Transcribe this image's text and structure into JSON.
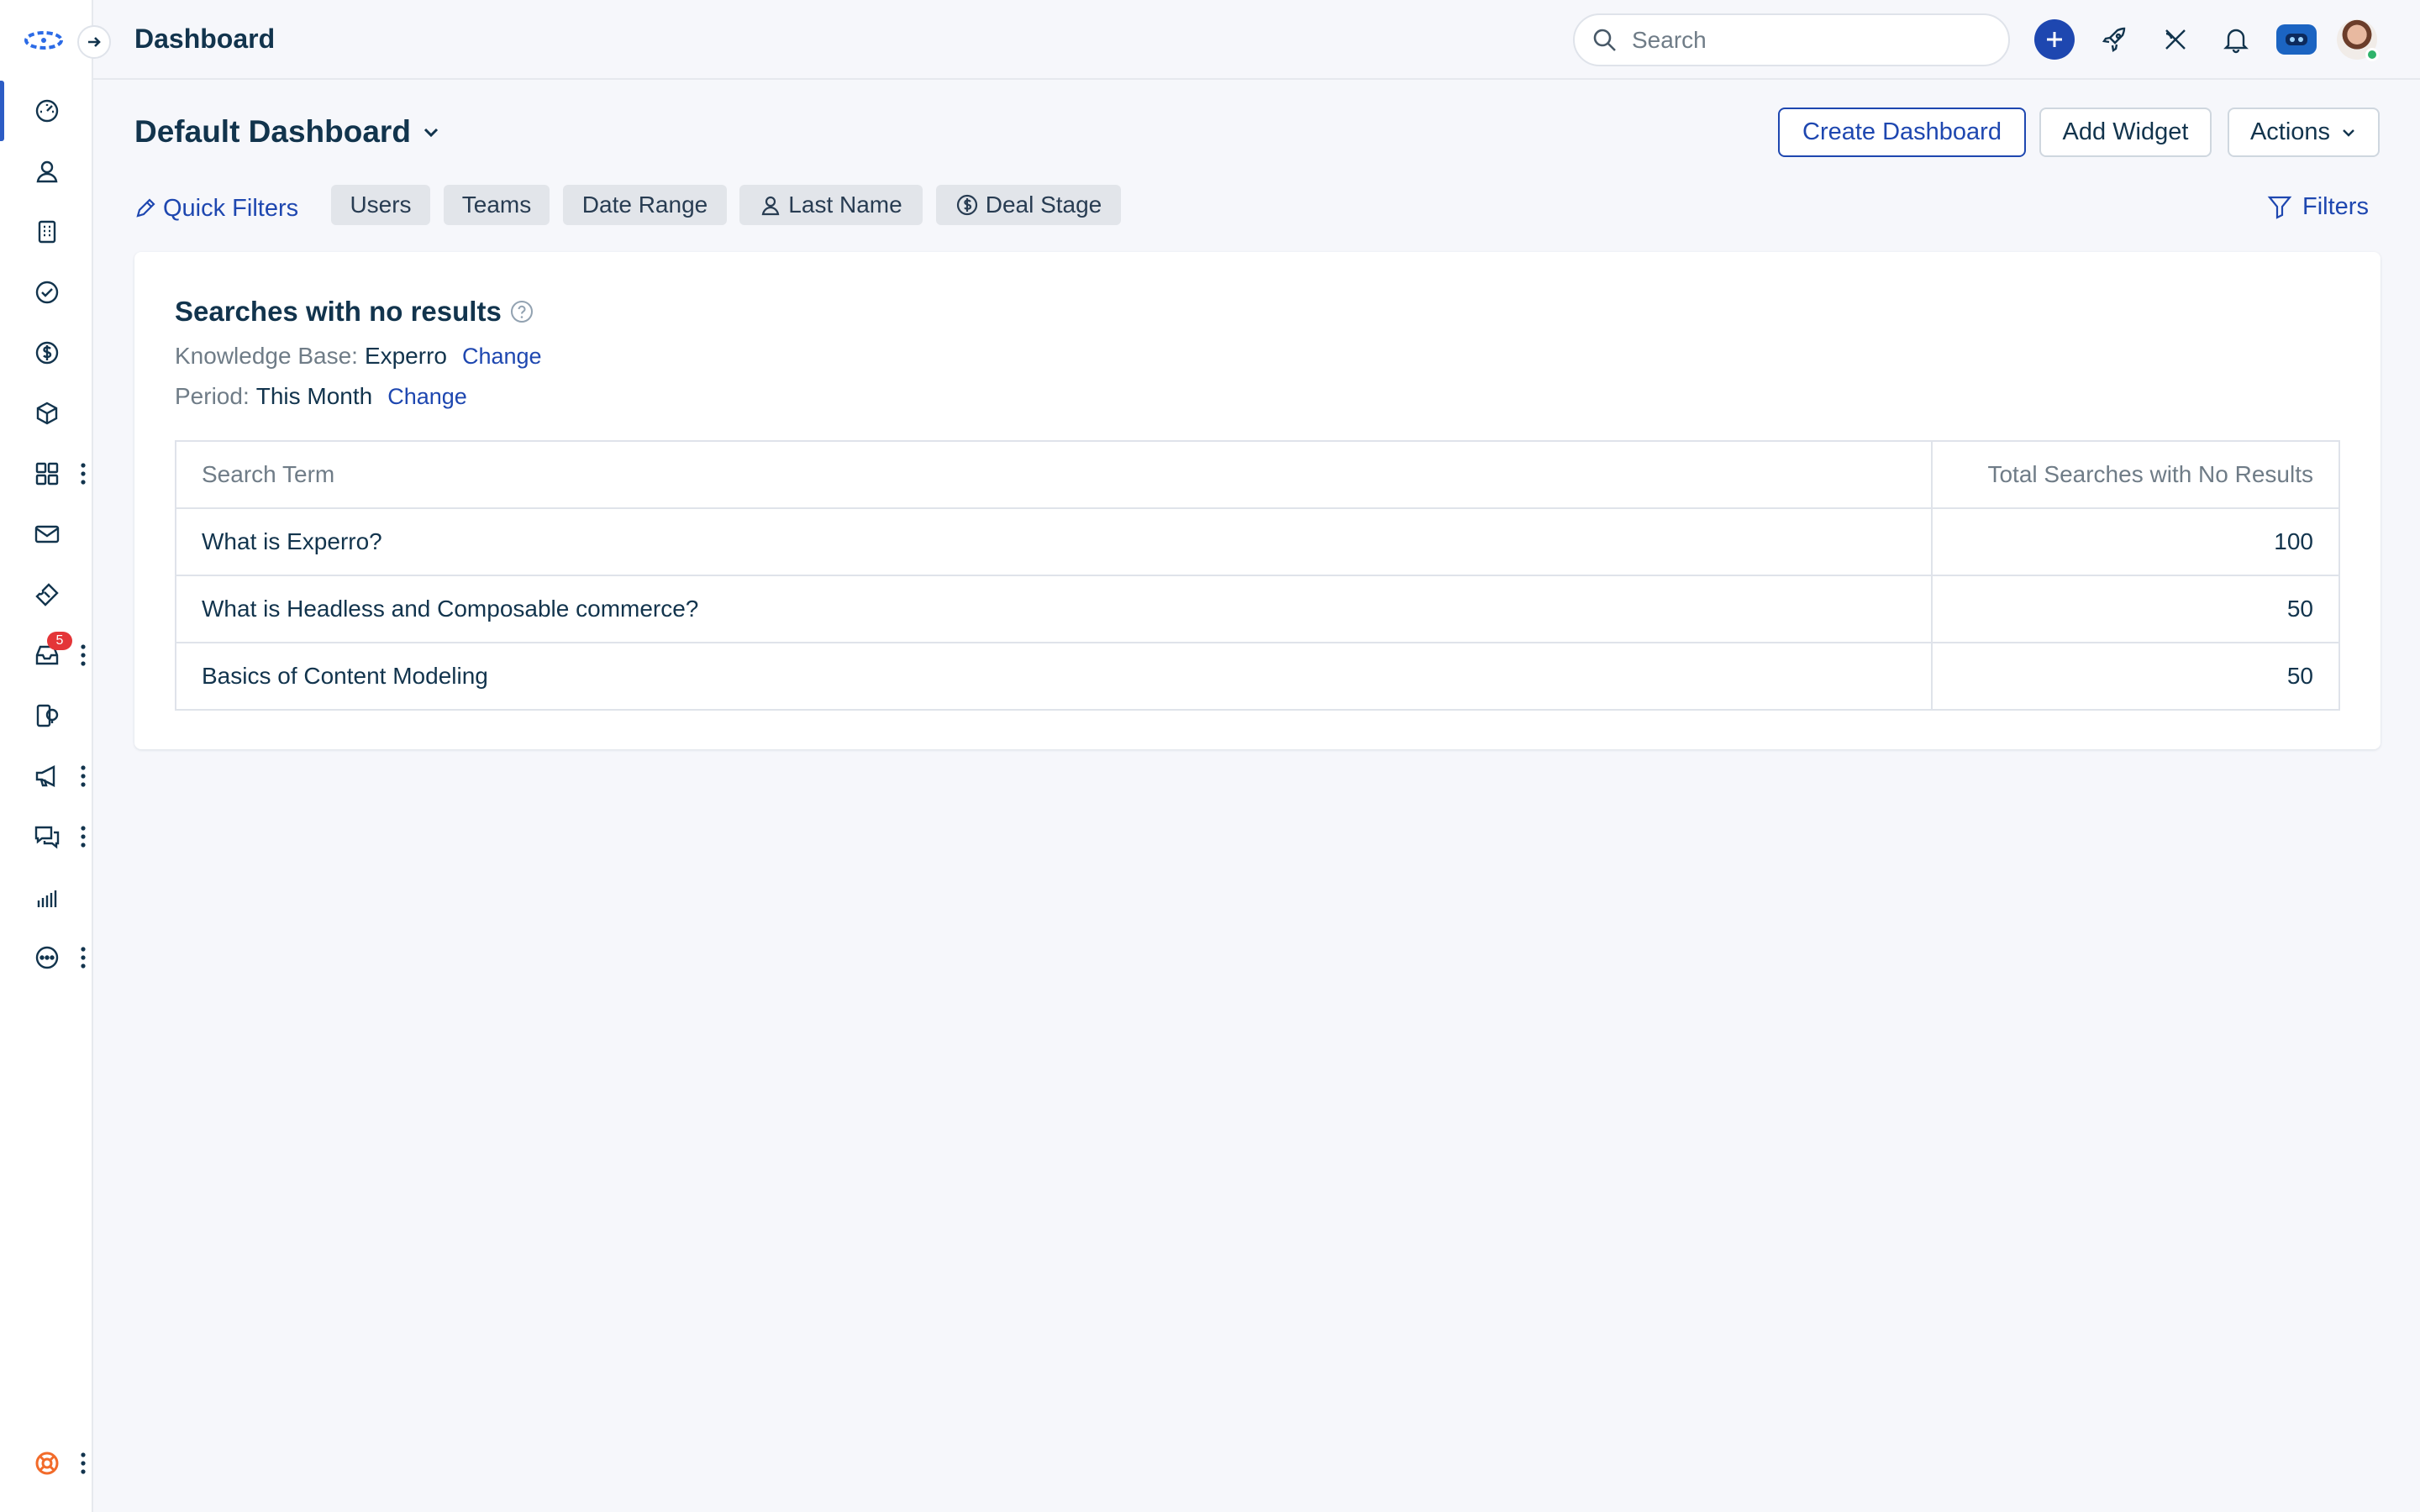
{
  "topbar": {
    "title": "Dashboard",
    "search_placeholder": "Search"
  },
  "sidebar": {
    "items": [
      {
        "icon": "dashboard-gauge-icon",
        "active": true
      },
      {
        "icon": "contacts-icon"
      },
      {
        "icon": "accounts-building-icon"
      },
      {
        "icon": "tasks-check-icon"
      },
      {
        "icon": "deals-dollar-icon"
      },
      {
        "icon": "products-box-icon"
      },
      {
        "icon": "apps-grid-icon",
        "more": true
      },
      {
        "icon": "email-icon"
      },
      {
        "icon": "tickets-icon"
      },
      {
        "icon": "inbox-icon",
        "more": true,
        "badge": "5"
      },
      {
        "icon": "knowledge-icon"
      },
      {
        "icon": "campaigns-megaphone-icon",
        "more": true
      },
      {
        "icon": "chat-icon",
        "more": true
      },
      {
        "icon": "reports-bars-icon"
      },
      {
        "icon": "more-options-icon",
        "more": true
      }
    ],
    "help_icon": "support-lifebuoy-icon"
  },
  "header": {
    "dashboard_name": "Default Dashboard",
    "create_label": "Create Dashboard",
    "add_widget_label": "Add Widget",
    "actions_label": "Actions"
  },
  "quick_filters": {
    "label": "Quick Filters",
    "chips": [
      "Users",
      "Teams",
      "Date Range",
      "Last Name",
      "Deal Stage"
    ],
    "filters_label": "Filters"
  },
  "widget": {
    "title": "Searches with no results",
    "kb_label": "Knowledge Base:",
    "kb_value": "Experro",
    "period_label": "Period:",
    "period_value": "This Month",
    "change_label": "Change",
    "columns": [
      "Search Term",
      "Total Searches with No Results"
    ],
    "rows": [
      {
        "term": "What is Experro?",
        "count": "100"
      },
      {
        "term": "What is Headless and Composable commerce?",
        "count": "50"
      },
      {
        "term": "Basics of Content Modeling",
        "count": "50"
      }
    ]
  },
  "colors": {
    "accent": "#1e47b0",
    "text": "#12344d",
    "muted": "#6f7c87",
    "badge": "#e43538"
  }
}
